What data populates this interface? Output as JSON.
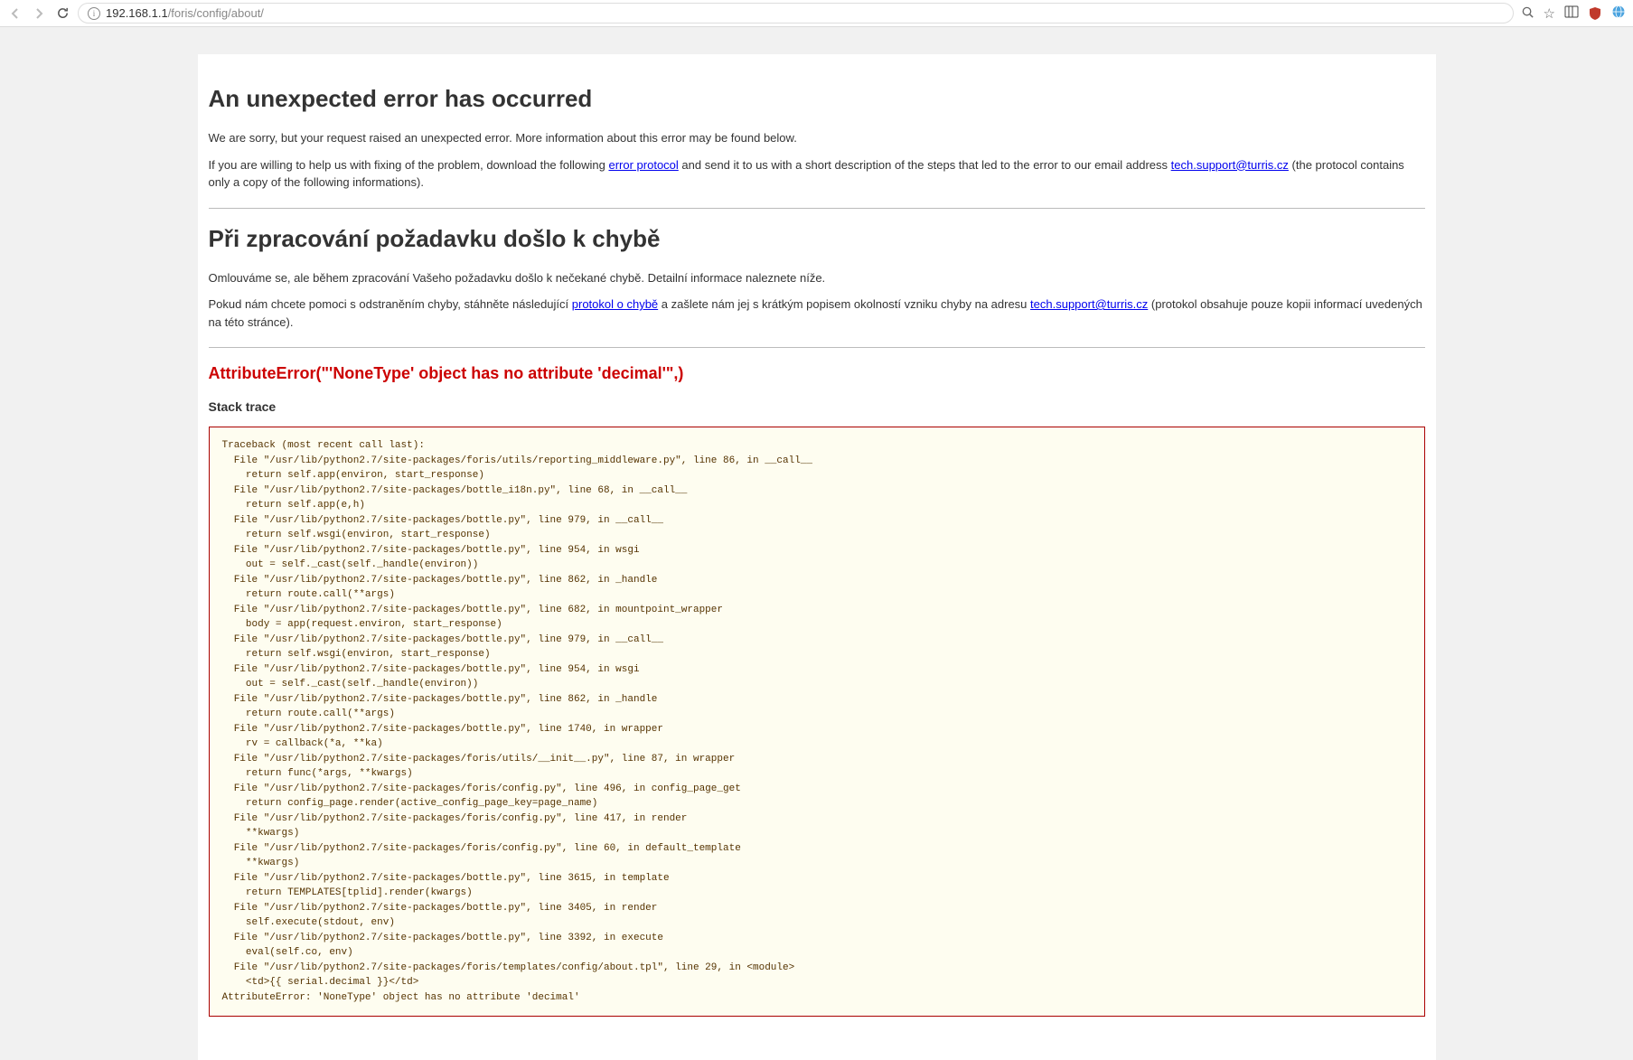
{
  "browser": {
    "url_host": "192.168.1.1",
    "url_path": "/foris/config/about/"
  },
  "en": {
    "heading": "An unexpected error has occurred",
    "p1": "We are sorry, but your request raised an unexpected error. More information about this error may be found below.",
    "p2_a": "If you are willing to help us with fixing of the problem, download the following ",
    "link_protocol": "error protocol",
    "p2_b": " and send it to us with a short description of the steps that led to the error to our email address ",
    "email": "tech.support@turris.cz",
    "p2_c": " (the protocol contains only a copy of the following informations)."
  },
  "cz": {
    "heading": "Při zpracování požadavku došlo k chybě",
    "p1": "Omlouváme se, ale během zpracování Vašeho požadavku došlo k nečekané chybě. Detailní informace naleznete níže.",
    "p2_a": "Pokud nám chcete pomoci s odstraněním chyby, stáhněte následující ",
    "link_protocol": "protokol o chybě",
    "p2_b": " a zašlete nám jej s krátkým popisem okolností vzniku chyby na adresu ",
    "email": "tech.support@turris.cz",
    "p2_c": " (protokol obsahuje pouze kopii informací uvedených na této stránce)."
  },
  "error": {
    "title": "AttributeError(\"'NoneType' object has no attribute 'decimal'\",)",
    "stack_label": "Stack trace",
    "traceback": "Traceback (most recent call last):\n  File \"/usr/lib/python2.7/site-packages/foris/utils/reporting_middleware.py\", line 86, in __call__\n    return self.app(environ, start_response)\n  File \"/usr/lib/python2.7/site-packages/bottle_i18n.py\", line 68, in __call__\n    return self.app(e,h)\n  File \"/usr/lib/python2.7/site-packages/bottle.py\", line 979, in __call__\n    return self.wsgi(environ, start_response)\n  File \"/usr/lib/python2.7/site-packages/bottle.py\", line 954, in wsgi\n    out = self._cast(self._handle(environ))\n  File \"/usr/lib/python2.7/site-packages/bottle.py\", line 862, in _handle\n    return route.call(**args)\n  File \"/usr/lib/python2.7/site-packages/bottle.py\", line 682, in mountpoint_wrapper\n    body = app(request.environ, start_response)\n  File \"/usr/lib/python2.7/site-packages/bottle.py\", line 979, in __call__\n    return self.wsgi(environ, start_response)\n  File \"/usr/lib/python2.7/site-packages/bottle.py\", line 954, in wsgi\n    out = self._cast(self._handle(environ))\n  File \"/usr/lib/python2.7/site-packages/bottle.py\", line 862, in _handle\n    return route.call(**args)\n  File \"/usr/lib/python2.7/site-packages/bottle.py\", line 1740, in wrapper\n    rv = callback(*a, **ka)\n  File \"/usr/lib/python2.7/site-packages/foris/utils/__init__.py\", line 87, in wrapper\n    return func(*args, **kwargs)\n  File \"/usr/lib/python2.7/site-packages/foris/config.py\", line 496, in config_page_get\n    return config_page.render(active_config_page_key=page_name)\n  File \"/usr/lib/python2.7/site-packages/foris/config.py\", line 417, in render\n    **kwargs)\n  File \"/usr/lib/python2.7/site-packages/foris/config.py\", line 60, in default_template\n    **kwargs)\n  File \"/usr/lib/python2.7/site-packages/bottle.py\", line 3615, in template\n    return TEMPLATES[tplid].render(kwargs)\n  File \"/usr/lib/python2.7/site-packages/bottle.py\", line 3405, in render\n    self.execute(stdout, env)\n  File \"/usr/lib/python2.7/site-packages/bottle.py\", line 3392, in execute\n    eval(self.co, env)\n  File \"/usr/lib/python2.7/site-packages/foris/templates/config/about.tpl\", line 29, in <module>\n    <td>{{ serial.decimal }}</td>\nAttributeError: 'NoneType' object has no attribute 'decimal'"
  }
}
